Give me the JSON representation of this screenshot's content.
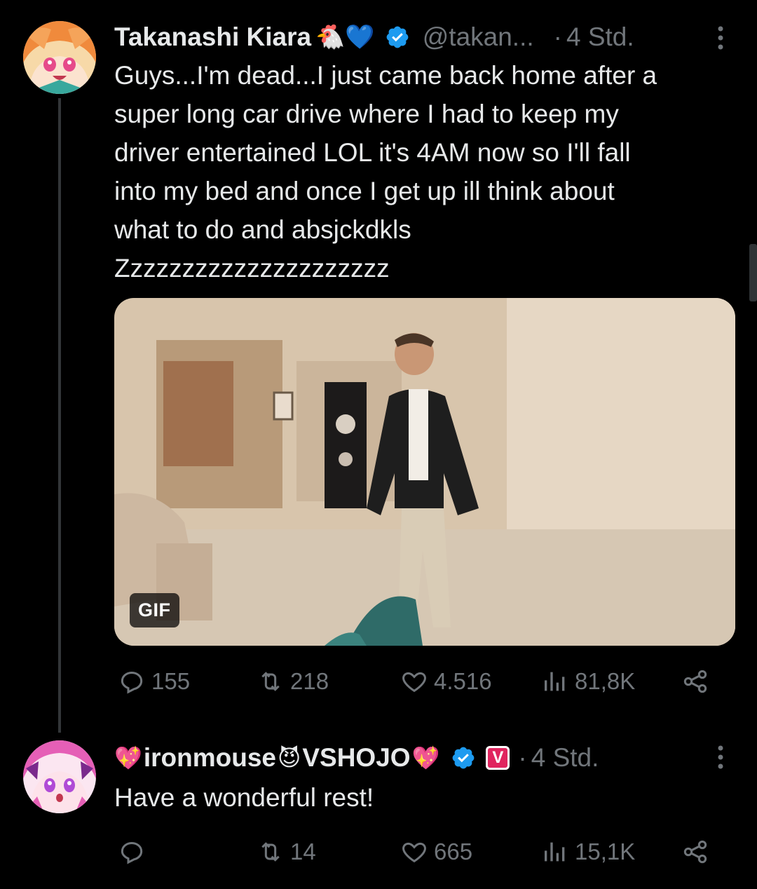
{
  "tweets": [
    {
      "display_name": "Takanashi Kiara",
      "name_emoji": "🐔💙",
      "handle": "@takan...",
      "separator": "·",
      "time": "4 Std.",
      "text_lines": [
        "Guys...I'm dead...I just came back home after a",
        "super long car drive where I had to keep my",
        "driver entertained LOL it's 4AM now so I'll fall",
        "into my bed and once I get up ill think about",
        "what to do and absjckdkls",
        "Zzzzzzzzzzzzzzzzzzzzz"
      ],
      "media_badge": "GIF",
      "actions": {
        "replies": "155",
        "reposts": "218",
        "likes": "4.516",
        "views": "81,8K"
      }
    },
    {
      "display_name_prefix": "💖",
      "display_name_main": "ironmouse",
      "display_name_mid": "😈",
      "display_name_suffix": "VSHOJO",
      "display_name_end": "💖",
      "affiliate_badge": "V",
      "separator": "·",
      "time": "4 Std.",
      "text": "Have a wonderful rest!",
      "actions": {
        "replies": "",
        "reposts": "14",
        "likes": "665",
        "views": "15,1K"
      }
    }
  ],
  "colors": {
    "background": "#000000",
    "text": "#e7e9ea",
    "muted": "#71767b",
    "verified": "#1d9bf0"
  },
  "icons": [
    "more-icon",
    "verified-icon",
    "reply-icon",
    "repost-icon",
    "like-icon",
    "views-icon",
    "share-icon"
  ]
}
